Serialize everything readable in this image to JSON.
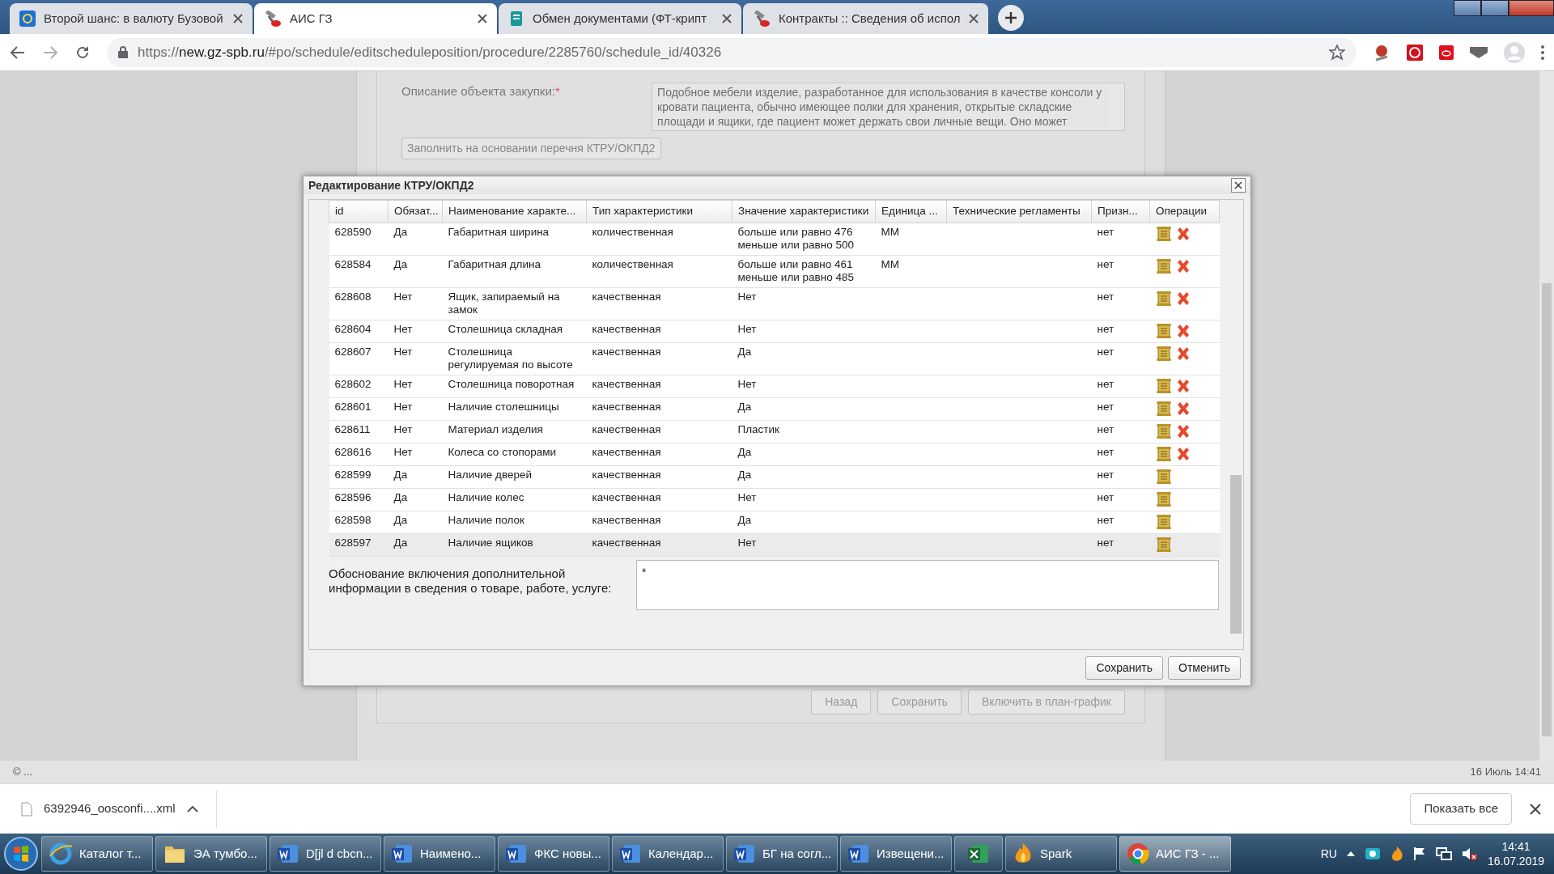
{
  "browser": {
    "tabs": [
      {
        "title": "Второй шанс: в валюту Бузовой",
        "kind": "mail",
        "selected": false
      },
      {
        "title": "АИС ГЗ",
        "kind": "tool",
        "selected": true
      },
      {
        "title": "Обмен документами (ФТ-крипт",
        "kind": "doc",
        "selected": false
      },
      {
        "title": "Контракты :: Сведения об испол",
        "kind": "tool",
        "selected": false
      }
    ],
    "url_scheme": "https://",
    "url_host": "new.gz-spb.ru",
    "url_path": "/#po/schedule/editscheduleposition/procedure/2285760/schedule_id/40326"
  },
  "form": {
    "description_label": "Описание объекта закупки:",
    "required_mark": "*",
    "description_value": "Подобное мебели изделие, разработанное для использования в качестве консоли у кровати пациента, обычно имеющее полки для хранения, открытые складские площади и ящики, где пациент может держать свои личные вещи. Оно может",
    "fill_button": "Заполнить на основании перечня КТРУ/ОКПД2",
    "buttons": [
      {
        "label": "Назад",
        "disabled": true
      },
      {
        "label": "Сохранить",
        "disabled": true
      },
      {
        "label": "Включить в план-график",
        "disabled": true
      }
    ]
  },
  "dialog": {
    "title": "Редактирование КТРУ/ОКПД2",
    "columns": [
      "id",
      "Обязат...",
      "Наименование характе...",
      "Тип характеристики",
      "Значение характеристики",
      "Единица ...",
      "Технические регламенты",
      "Призн...",
      "Операции"
    ],
    "rows": [
      {
        "id": "628590",
        "required": "Да",
        "name": "Габаритная ширина",
        "type": "количественная",
        "value": "больше или равно 476\nменьше или равно 500",
        "unit": "ММ",
        "flag": "нет",
        "deletable": true,
        "selected": false
      },
      {
        "id": "628584",
        "required": "Да",
        "name": "Габаритная длина",
        "type": "количественная",
        "value": "больше или равно 461\nменьше или равно 485",
        "unit": "ММ",
        "flag": "нет",
        "deletable": true,
        "selected": false
      },
      {
        "id": "628608",
        "required": "Нет",
        "name": "Ящик, запираемый на замок",
        "type": "качественная",
        "value": "Нет",
        "unit": "",
        "flag": "нет",
        "deletable": true,
        "selected": false
      },
      {
        "id": "628604",
        "required": "Нет",
        "name": "Столешница складная",
        "type": "качественная",
        "value": "Нет",
        "unit": "",
        "flag": "нет",
        "deletable": true,
        "selected": false
      },
      {
        "id": "628607",
        "required": "Нет",
        "name": "Столешница регулируемая по высоте",
        "type": "качественная",
        "value": "Да",
        "unit": "",
        "flag": "нет",
        "deletable": true,
        "selected": false
      },
      {
        "id": "628602",
        "required": "Нет",
        "name": "Столешница поворотная",
        "type": "качественная",
        "value": "Нет",
        "unit": "",
        "flag": "нет",
        "deletable": true,
        "selected": false
      },
      {
        "id": "628601",
        "required": "Нет",
        "name": "Наличие столешницы",
        "type": "качественная",
        "value": "Да",
        "unit": "",
        "flag": "нет",
        "deletable": true,
        "selected": false
      },
      {
        "id": "628611",
        "required": "Нет",
        "name": "Материал изделия",
        "type": "качественная",
        "value": "Пластик",
        "unit": "",
        "flag": "нет",
        "deletable": true,
        "selected": false
      },
      {
        "id": "628616",
        "required": "Нет",
        "name": "Колеса со стопорами",
        "type": "качественная",
        "value": "Да",
        "unit": "",
        "flag": "нет",
        "deletable": true,
        "selected": false
      },
      {
        "id": "628599",
        "required": "Да",
        "name": "Наличие дверей",
        "type": "качественная",
        "value": "Да",
        "unit": "",
        "flag": "нет",
        "deletable": false,
        "selected": false
      },
      {
        "id": "628596",
        "required": "Да",
        "name": "Наличие колес",
        "type": "качественная",
        "value": "Нет",
        "unit": "",
        "flag": "нет",
        "deletable": false,
        "selected": false
      },
      {
        "id": "628598",
        "required": "Да",
        "name": "Наличие полок",
        "type": "качественная",
        "value": "Да",
        "unit": "",
        "flag": "нет",
        "deletable": false,
        "selected": false
      },
      {
        "id": "628597",
        "required": "Да",
        "name": "Наличие ящиков",
        "type": "качественная",
        "value": "Нет",
        "unit": "",
        "flag": "нет",
        "deletable": false,
        "selected": true
      }
    ],
    "justification_label": "Обоснование включения дополнительной информации в сведения о товаре, работе, услуге:",
    "justification_value": "*",
    "buttons": [
      "Сохранить",
      "Отменить"
    ]
  },
  "footer": {
    "left": "© ...",
    "right": "16 Июль 14:41"
  },
  "downloads": {
    "file": "6392946_oosconfi....xml",
    "show_all": "Показать все"
  },
  "taskbar": {
    "items": [
      {
        "label": "Каталог т...",
        "kind": "ie",
        "selected": false
      },
      {
        "label": "ЭА тумбо...",
        "kind": "folder",
        "selected": false
      },
      {
        "label": "D[jl d cbcn...",
        "kind": "word",
        "selected": false
      },
      {
        "label": "Наимено...",
        "kind": "word",
        "selected": false
      },
      {
        "label": "ФКС новы...",
        "kind": "word",
        "selected": false
      },
      {
        "label": "Календар...",
        "kind": "word",
        "selected": false
      },
      {
        "label": "БГ на согл...",
        "kind": "word",
        "selected": false
      },
      {
        "label": "Извещени...",
        "kind": "word",
        "selected": false
      },
      {
        "kind": "excel",
        "selected": false
      },
      {
        "label": "Spark",
        "kind": "spark",
        "selected": false
      },
      {
        "label": "АИС ГЗ - ...",
        "kind": "chrome",
        "selected": true
      }
    ],
    "language": "RU",
    "time": "14:41",
    "date": "16.07.2019"
  }
}
